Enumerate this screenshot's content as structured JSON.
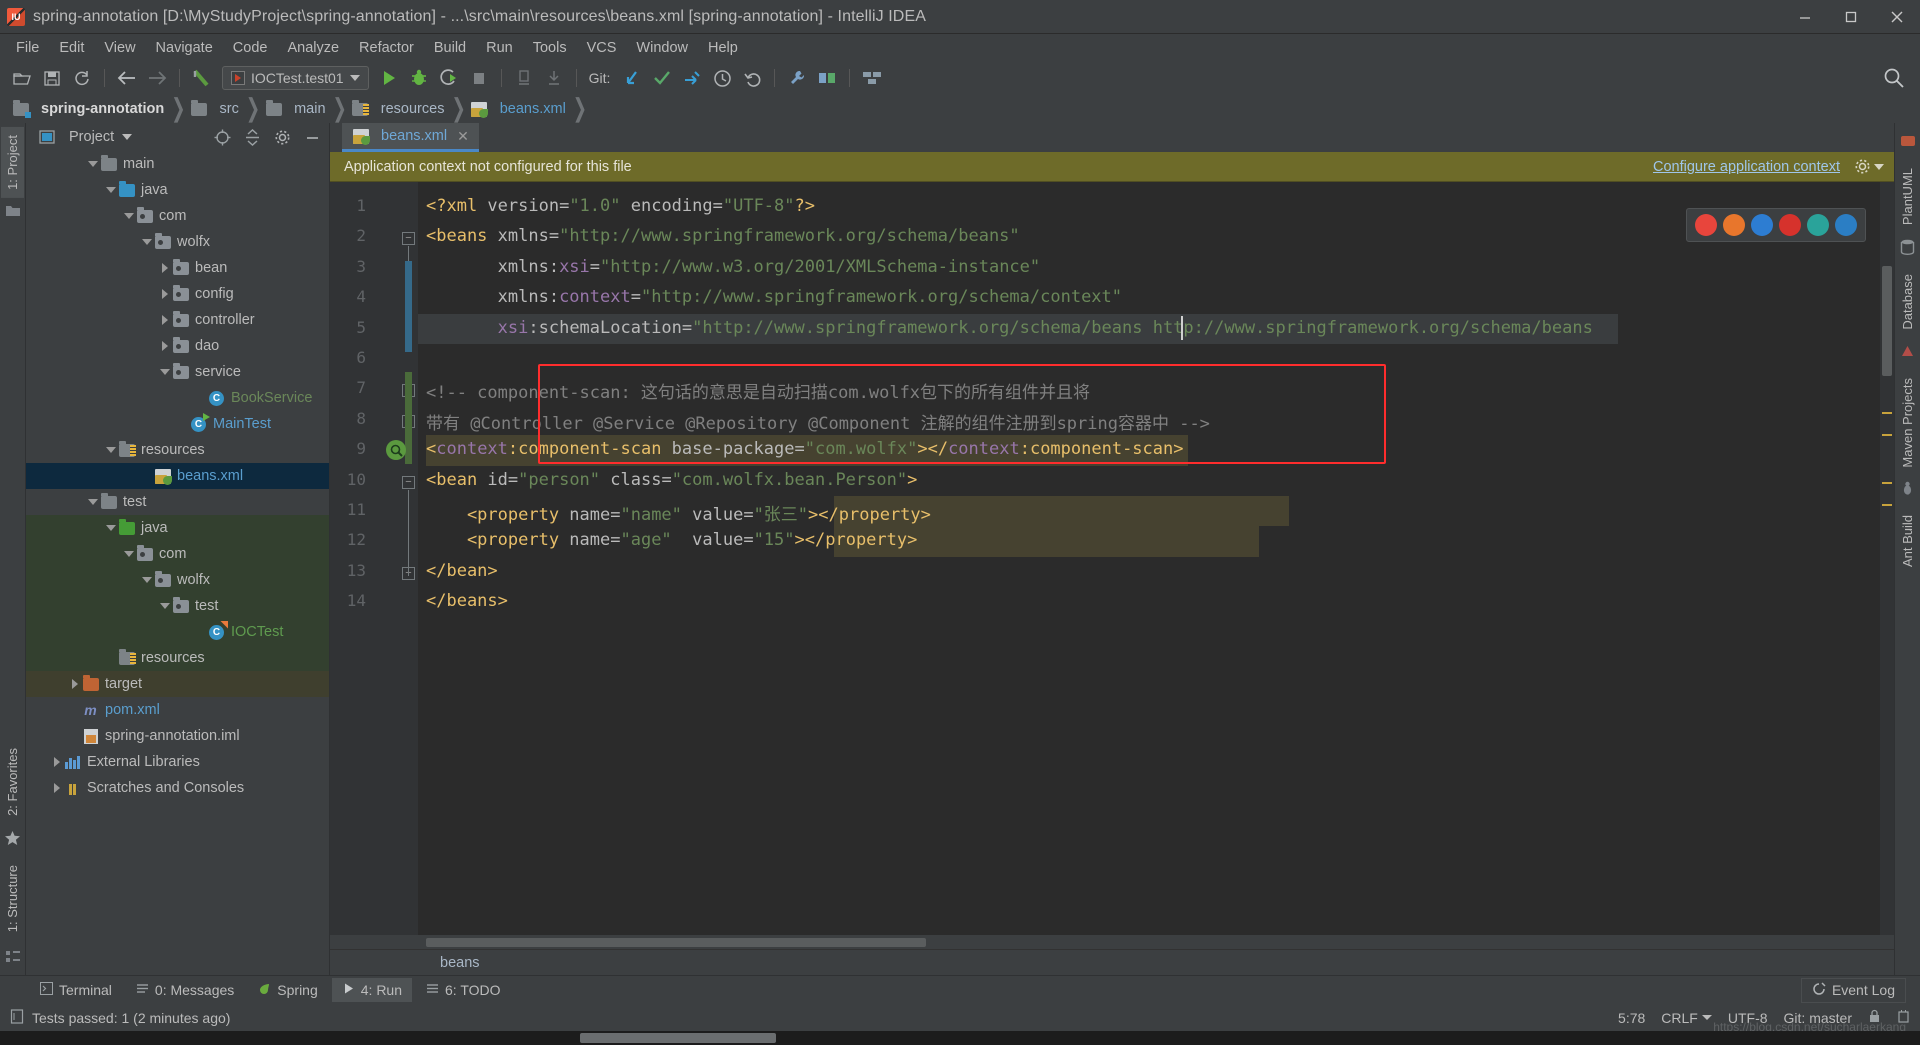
{
  "window": {
    "title": "spring-annotation [D:\\MyStudyProject\\spring-annotation] - ...\\src\\main\\resources\\beans.xml [spring-annotation] - IntelliJ IDEA",
    "minimize_label": "—",
    "maximize_label": "□",
    "close_label": "✕"
  },
  "menu": [
    {
      "label": "File"
    },
    {
      "label": "Edit"
    },
    {
      "label": "View"
    },
    {
      "label": "Navigate"
    },
    {
      "label": "Code"
    },
    {
      "label": "Analyze"
    },
    {
      "label": "Refactor"
    },
    {
      "label": "Build"
    },
    {
      "label": "Run"
    },
    {
      "label": "Tools"
    },
    {
      "label": "VCS"
    },
    {
      "label": "Window"
    },
    {
      "label": "Help"
    }
  ],
  "toolbar": {
    "run_config": "IOCTest.test01",
    "git_label": "Git:",
    "icons": [
      "open-folder-icon",
      "save-all-icon",
      "sync-icon",
      "back-arrow-icon",
      "forward-arrow-icon",
      "build-icon",
      "run-icon",
      "debug-icon",
      "run-coverage-icon",
      "stop-icon",
      "profile-icon",
      "attach-icon",
      "update-project-icon",
      "commit-icon",
      "push-icon",
      "history-icon",
      "undo-icon",
      "settings-wrench-icon",
      "project-structure-icon",
      "compare-icon",
      "search-everywhere-icon"
    ]
  },
  "breadcrumbs": [
    {
      "label": "spring-annotation",
      "icon": "module-folder-icon",
      "style": "bold"
    },
    {
      "label": "src",
      "icon": "folder-icon",
      "style": "normal"
    },
    {
      "label": "main",
      "icon": "folder-icon",
      "style": "normal"
    },
    {
      "label": "resources",
      "icon": "resources-folder-icon",
      "style": "normal"
    },
    {
      "label": "beans.xml",
      "icon": "spring-xml-icon",
      "style": "xml"
    }
  ],
  "left_strip": [
    {
      "label": "1: Project",
      "active": true
    },
    {
      "label": "2: Favorites",
      "active": false
    },
    {
      "label": "1: Structure",
      "active": false
    }
  ],
  "right_strip": [
    {
      "label": "PlantUML"
    },
    {
      "label": "Database"
    },
    {
      "label": "Maven Projects"
    },
    {
      "label": "Ant Build"
    }
  ],
  "project_panel": {
    "title": "Project",
    "header_icons": [
      "target-icon",
      "collapse-all-icon",
      "gear-icon",
      "hide-icon"
    ],
    "tree": [
      {
        "label": "main",
        "indent": 3,
        "arrow": "down",
        "icon": "folder-grey",
        "color": "w",
        "state": "none"
      },
      {
        "label": "java",
        "indent": 4,
        "arrow": "down",
        "icon": "folder-blue",
        "color": "w",
        "state": "none"
      },
      {
        "label": "com",
        "indent": 5,
        "arrow": "down",
        "icon": "folder-pkg",
        "color": "w",
        "state": "none"
      },
      {
        "label": "wolfx",
        "indent": 6,
        "arrow": "down",
        "icon": "folder-pkg",
        "color": "w",
        "state": "none"
      },
      {
        "label": "bean",
        "indent": 7,
        "arrow": "right",
        "icon": "folder-pkg",
        "color": "w",
        "state": "none"
      },
      {
        "label": "config",
        "indent": 7,
        "arrow": "right",
        "icon": "folder-pkg",
        "color": "w",
        "state": "none"
      },
      {
        "label": "controller",
        "indent": 7,
        "arrow": "right",
        "icon": "folder-pkg",
        "color": "w",
        "state": "none"
      },
      {
        "label": "dao",
        "indent": 7,
        "arrow": "right",
        "icon": "folder-pkg",
        "color": "w",
        "state": "none"
      },
      {
        "label": "service",
        "indent": 7,
        "arrow": "down",
        "icon": "folder-pkg",
        "color": "w",
        "state": "none"
      },
      {
        "label": "BookService",
        "indent": 9,
        "arrow": "none",
        "icon": "class-icon",
        "color": "green",
        "state": "none"
      },
      {
        "label": "MainTest",
        "indent": 8,
        "arrow": "none",
        "icon": "class-run-icon",
        "color": "blue",
        "state": "none"
      },
      {
        "label": "resources",
        "indent": 4,
        "arrow": "down",
        "icon": "folder-res",
        "color": "w",
        "state": "none"
      },
      {
        "label": "beans.xml",
        "indent": 6,
        "arrow": "none",
        "icon": "spring-xml-icon",
        "color": "blue",
        "state": "selected"
      },
      {
        "label": "test",
        "indent": 3,
        "arrow": "down",
        "icon": "folder-grey",
        "color": "w",
        "state": "none"
      },
      {
        "label": "java",
        "indent": 4,
        "arrow": "down",
        "icon": "folder-green",
        "color": "w",
        "state": "testscope"
      },
      {
        "label": "com",
        "indent": 5,
        "arrow": "down",
        "icon": "folder-pkg",
        "color": "w",
        "state": "testscope"
      },
      {
        "label": "wolfx",
        "indent": 6,
        "arrow": "down",
        "icon": "folder-pkg",
        "color": "w",
        "state": "testscope"
      },
      {
        "label": "test",
        "indent": 7,
        "arrow": "down",
        "icon": "folder-pkg",
        "color": "w",
        "state": "testscope"
      },
      {
        "label": "IOCTest",
        "indent": 9,
        "arrow": "none",
        "icon": "class-test-icon",
        "color": "greenlight",
        "state": "testscope"
      },
      {
        "label": "resources",
        "indent": 4,
        "arrow": "none",
        "icon": "folder-res",
        "color": "w",
        "state": "testscope"
      },
      {
        "label": "target",
        "indent": 2,
        "arrow": "right",
        "icon": "folder-orange",
        "color": "w",
        "state": "target"
      },
      {
        "label": "pom.xml",
        "indent": 2,
        "arrow": "none",
        "icon": "maven-icon",
        "color": "blue",
        "state": "none"
      },
      {
        "label": "spring-annotation.iml",
        "indent": 2,
        "arrow": "none",
        "icon": "iml-icon",
        "color": "w",
        "state": "none"
      },
      {
        "label": "External Libraries",
        "indent": 1,
        "arrow": "right",
        "icon": "libraries-icon",
        "color": "w",
        "state": "none"
      },
      {
        "label": "Scratches and Consoles",
        "indent": 1,
        "arrow": "right",
        "icon": "scratches-icon",
        "color": "w",
        "state": "none"
      }
    ]
  },
  "editor": {
    "tab": {
      "name": "beans.xml",
      "icon": "spring-xml-icon",
      "close": "✕"
    },
    "notification": {
      "message": "Application context not configured for this file",
      "action": "Configure application context",
      "gear_icon": "gear-icon"
    },
    "breadcrumb_footer": "beans",
    "browser_popup": [
      "chrome-icon",
      "firefox-icon",
      "safari-icon",
      "opera-icon",
      "edge-icon",
      "ie-icon"
    ],
    "line_numbers": [
      "1",
      "2",
      "3",
      "4",
      "5",
      "6",
      "7",
      "8",
      "9",
      "10",
      "11",
      "12",
      "13",
      "14"
    ],
    "lines": [
      {
        "n": 1,
        "segments": [
          {
            "t": "<?xml ",
            "c": "c-pi"
          },
          {
            "t": "version=",
            "c": "c-attr"
          },
          {
            "t": "\"1.0\"",
            "c": "c-str"
          },
          {
            "t": " encoding=",
            "c": "c-attr"
          },
          {
            "t": "\"UTF-8\"",
            "c": "c-str"
          },
          {
            "t": "?>",
            "c": "c-pi"
          }
        ]
      },
      {
        "n": 2,
        "segments": [
          {
            "t": "<beans",
            "c": "c-tag"
          },
          {
            "t": " xmlns=",
            "c": "c-attr"
          },
          {
            "t": "\"http://www.springframework.org/schema/beans\"",
            "c": "c-str"
          }
        ]
      },
      {
        "n": 3,
        "segments": [
          {
            "t": "       xmlns:",
            "c": "c-attr"
          },
          {
            "t": "xsi",
            "c": "c-ns"
          },
          {
            "t": "=",
            "c": "c-attr"
          },
          {
            "t": "\"http://www.w3.org/2001/XMLSchema-instance\"",
            "c": "c-str"
          }
        ]
      },
      {
        "n": 4,
        "segments": [
          {
            "t": "       xmlns:",
            "c": "c-attr"
          },
          {
            "t": "context",
            "c": "c-ns"
          },
          {
            "t": "=",
            "c": "c-attr"
          },
          {
            "t": "\"http://www.springframework.org/schema/context\"",
            "c": "c-str"
          }
        ]
      },
      {
        "n": 5,
        "segments": [
          {
            "t": "       ",
            "c": "c-attr"
          },
          {
            "t": "xsi",
            "c": "c-ns"
          },
          {
            "t": ":schemaLocation=",
            "c": "c-attr"
          },
          {
            "t": "\"http://www.springframework.org/schema/beans http://www.springframework.org/schema/beans",
            "c": "c-str"
          }
        ]
      },
      {
        "n": 6,
        "segments": []
      },
      {
        "n": 7,
        "segments": [
          {
            "t": "<!-- component-scan: 这句话的意思是自动扫描com.wolfx包下的所有组件并且将",
            "c": "c-cmt"
          }
        ]
      },
      {
        "n": 8,
        "segments": [
          {
            "t": "带有 @Controller @Service @Repository @Component 注解的组件注册到spring容器中 -->",
            "c": "c-cmt"
          }
        ]
      },
      {
        "n": 9,
        "segments": [
          {
            "t": "<",
            "c": "c-tag"
          },
          {
            "t": "context",
            "c": "c-ns"
          },
          {
            "t": ":component-scan",
            "c": "c-tag"
          },
          {
            "t": " base-package=",
            "c": "c-attr"
          },
          {
            "t": "\"com.wolfx\"",
            "c": "c-str"
          },
          {
            "t": ">",
            "c": "c-tag"
          },
          {
            "t": "</",
            "c": "c-tag"
          },
          {
            "t": "context",
            "c": "c-ns"
          },
          {
            "t": ":component-scan>",
            "c": "c-tag"
          }
        ]
      },
      {
        "n": 10,
        "segments": [
          {
            "t": "<bean",
            "c": "c-tag"
          },
          {
            "t": " id=",
            "c": "c-attr"
          },
          {
            "t": "\"person\"",
            "c": "c-str"
          },
          {
            "t": " class=",
            "c": "c-attr"
          },
          {
            "t": "\"com.wolfx.bean.Person\"",
            "c": "c-str"
          },
          {
            "t": ">",
            "c": "c-tag"
          }
        ]
      },
      {
        "n": 11,
        "segments": [
          {
            "t": "    <property",
            "c": "c-tag"
          },
          {
            "t": " name=",
            "c": "c-attr"
          },
          {
            "t": "\"name\"",
            "c": "c-str"
          },
          {
            "t": " value=",
            "c": "c-attr"
          },
          {
            "t": "\"张三\"",
            "c": "c-str"
          },
          {
            "t": ">",
            "c": "c-tag"
          },
          {
            "t": "</property>",
            "c": "c-tag"
          }
        ]
      },
      {
        "n": 12,
        "segments": [
          {
            "t": "    <property",
            "c": "c-tag"
          },
          {
            "t": " name=",
            "c": "c-attr"
          },
          {
            "t": "\"age\"",
            "c": "c-str"
          },
          {
            "t": "  value=",
            "c": "c-attr"
          },
          {
            "t": "\"15\"",
            "c": "c-str"
          },
          {
            "t": ">",
            "c": "c-tag"
          },
          {
            "t": "</property>",
            "c": "c-tag"
          }
        ]
      },
      {
        "n": 13,
        "segments": [
          {
            "t": "</bean>",
            "c": "c-tag"
          }
        ]
      },
      {
        "n": 14,
        "segments": [
          {
            "t": "</beans>",
            "c": "c-tag"
          }
        ]
      }
    ]
  },
  "tool_windows": [
    {
      "label": "Terminal",
      "icon": "terminal-icon",
      "active": false
    },
    {
      "label": "0: Messages",
      "icon": "messages-icon",
      "active": false
    },
    {
      "label": "Spring",
      "icon": "spring-leaf-icon",
      "active": false
    },
    {
      "label": "4: Run",
      "icon": "run-icon",
      "active": true
    },
    {
      "label": "6: TODO",
      "icon": "todo-icon",
      "active": false
    }
  ],
  "event_log": {
    "label": "Event Log",
    "icon": "event-log-icon"
  },
  "status_bar": {
    "message": "Tests passed: 1 (2 minutes ago)",
    "caret": "5:78",
    "line_sep": "CRLF",
    "encoding": "UTF-8",
    "branch": "Git: master",
    "lock_icon": "lock-icon",
    "watermark": "https://blog.csdn.net/sucharlaerkang"
  }
}
